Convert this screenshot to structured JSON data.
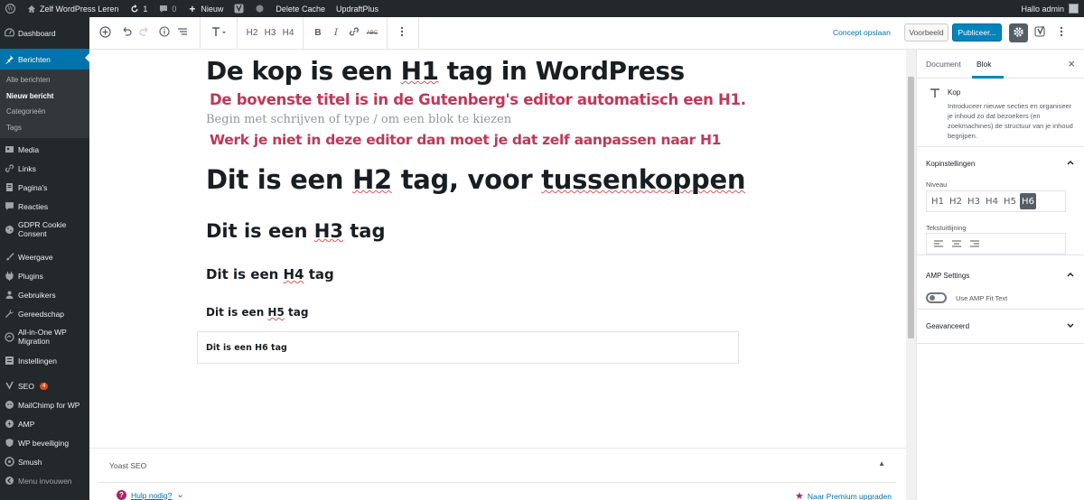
{
  "adminbar": {
    "site": "Zelf WordPress Leren",
    "updates": "1",
    "comments": "0",
    "new": "Nieuw",
    "delete_cache": "Delete Cache",
    "updraft": "UpdraftPlus",
    "greeting": "Hallo admin"
  },
  "sidebar": {
    "dashboard": "Dashboard",
    "berichten": "Berichten",
    "sub": [
      "Alle berichten",
      "Nieuw bericht",
      "Categorieën",
      "Tags"
    ],
    "items": [
      "Media",
      "Links",
      "Pagina's",
      "Reacties",
      "GDPR Cookie Consent",
      "Weergave",
      "Plugins",
      "Gebruikers",
      "Gereedschap",
      "All-in-One WP Migration",
      "Instellingen",
      "SEO",
      "MailChimp for WP",
      "AMP",
      "WP beveiliging",
      "Smush",
      "Menu invouwen"
    ],
    "seo_badge": "4"
  },
  "toolbar": {
    "heading_levels": [
      "H2",
      "H3",
      "H4"
    ],
    "draft": "Concept opslaan",
    "preview": "Voorbeeld",
    "publish": "Publiceer..."
  },
  "editor": {
    "h1": {
      "before": "De kop is een ",
      "mark": "H1",
      "after": " tag in WordPress"
    },
    "note1": "De bovenste titel is in de Gutenberg's editor automatisch een H1.",
    "placeholder": "Begin met schrijven of type / om een blok te kiezen",
    "note2": "Werk je niet in deze editor dan moet je dat zelf aanpassen naar H1",
    "h2": {
      "a": "Dit is een ",
      "mark1": "H2",
      "b": " tag, voor ",
      "mark2": "tussenkoppen"
    },
    "h3": {
      "a": "Dit is een ",
      "mark": "H3",
      "b": " tag"
    },
    "h4": {
      "a": "Dit is een ",
      "mark": "H4",
      "b": " tag"
    },
    "h5": {
      "a": "Dit is een ",
      "mark": "H5",
      "b": " tag"
    },
    "h6": "Dit is een H6 tag"
  },
  "yoast": {
    "title": "Yoast SEO",
    "help": "Hulp nodig?",
    "premium": "Naar Premium upgraden"
  },
  "panel": {
    "tab_document": "Document",
    "tab_blok": "Blok",
    "block_title": "Kop",
    "block_desc": "Introduceer nieuwe secties en organiseer je inhoud zo dat bezoekers (en zoekmachines) de structuur van je inhoud begrijpen.",
    "kop_title": "Kopinstellingen",
    "niveau": "Niveau",
    "levels": [
      "H1",
      "H2",
      "H3",
      "H4",
      "H5",
      "H6"
    ],
    "selected_level": "H6",
    "uitlijning": "Tekstuitlijning",
    "amp_title": "AMP Settings",
    "amp_toggle": "Use AMP Fit Text",
    "advanced": "Geavanceerd"
  },
  "colors": {
    "accent": "#0073aa",
    "note": "#c0375a",
    "adminbar": "#23282d"
  }
}
